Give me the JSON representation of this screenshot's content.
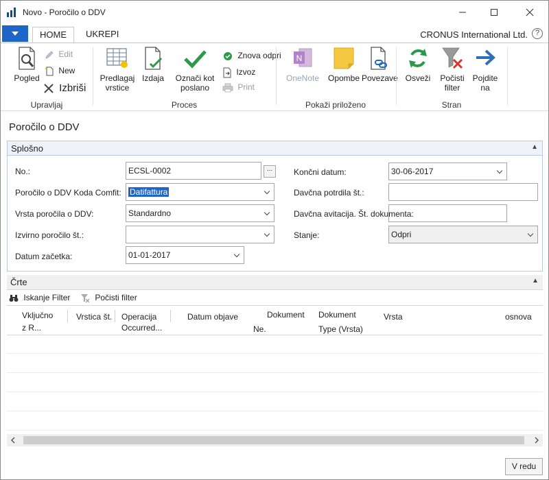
{
  "window": {
    "title": "Novo - Poročilo o DDV"
  },
  "ribbon_tabs": {
    "home": "HOME",
    "ukrepi": "UKREPI"
  },
  "company": "CRONUS International Ltd.",
  "help": "?",
  "ribbon": {
    "upravljaj": {
      "label": "Upravljaj",
      "pogled": "Pogled",
      "edit": "Edit",
      "new": "New",
      "izbrisi": "Izbriši"
    },
    "proces": {
      "label": "Proces",
      "predlagaj": "Predlagaj vrstice",
      "izdaja": "Izdaja",
      "oznaci": "Označi kot poslano",
      "znova_odpri": "Znova odpri",
      "izvoz": "Izvoz",
      "print": "Print"
    },
    "prilozeno": {
      "label": "Pokaži priloženo",
      "onenote": "OneNote",
      "opombe": "Opombe",
      "povezave": "Povezave"
    },
    "stran": {
      "label": "Stran",
      "osvezi": "Osveži",
      "pocisti": "Počisti filter",
      "pojdite": "Pojdite na"
    }
  },
  "page_title": "Poročilo o DDV",
  "general": {
    "header": "Splošno",
    "fields": {
      "no_label": "No.:",
      "no_value": "ECSL-0002",
      "koda_label": "Poročilo o DDV Koda Comfit:",
      "koda_value": "Datifattura",
      "vrsta_label": "Vrsta poročila o DDV:",
      "vrsta_value": "Standardno",
      "izvirno_label": "Izvirno poročilo št.:",
      "izvirno_value": "",
      "datum_zacetka_label": "Datum začetka:",
      "datum_zacetka_value": "01-01-2017",
      "koncni_label": "Končni datum:",
      "koncni_value": "30-06-2017",
      "potrdila_label": "Davčna potrdila št.:",
      "potrdila_value": "",
      "avitacija_label": "Davčna avitacija. Št. dokumenta:",
      "avitacija_value": "",
      "stanje_label": "Stanje:",
      "stanje_value": "Odpri"
    }
  },
  "lines": {
    "header": "Črte",
    "search_filter": "Iskanje Filter",
    "clear_filter": "Počisti filter",
    "columns": [
      {
        "line1": "Vključno",
        "line2": "z R..."
      },
      {
        "line1": "Vrstica št.",
        "line2": ""
      },
      {
        "line1": "Operacija",
        "line2": "Occurred..."
      },
      {
        "line1": "Datum objave",
        "line2": ""
      },
      {
        "line1": "Dokument",
        "line2": "Ne."
      },
      {
        "line1": "Dokument",
        "line2": "Type (Vrsta)"
      },
      {
        "line1": "Vrsta",
        "line2": ""
      },
      {
        "line1": "osnova",
        "line2": ""
      }
    ]
  },
  "ok_button": "V redu"
}
